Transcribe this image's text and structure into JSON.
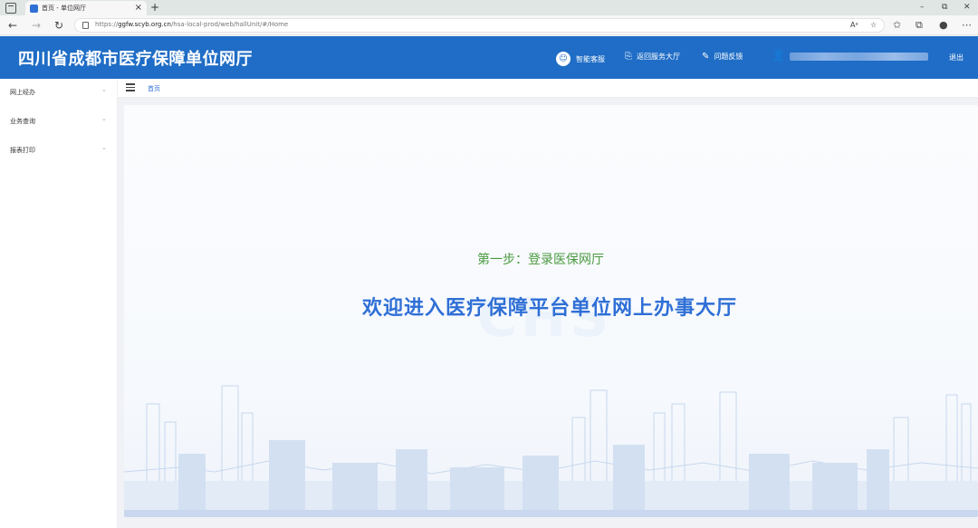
{
  "browser": {
    "tab_title": "首页 - 单位网厅",
    "url_prefix": "https://",
    "url_host": "ggfw.scyb.org.cn",
    "url_path": "/hsa-local-prod/web/hallUnit/#/Home"
  },
  "header": {
    "title": "四川省成都市医疗保障单位网厅",
    "service_label": "智能客服",
    "return_label": "返回服务大厅",
    "feedback_label": "问题反馈",
    "logout_label": "退出"
  },
  "sidebar": {
    "items": [
      {
        "label": "网上经办"
      },
      {
        "label": "业务查询"
      },
      {
        "label": "报表打印"
      }
    ]
  },
  "breadcrumb": {
    "home": "首页"
  },
  "main": {
    "step_text": "第一步：登录医保网厅",
    "welcome_text": "欢迎进入医疗保障平台单位网上办事大厅",
    "watermark": "CHS"
  },
  "colors": {
    "brand_blue": "#1f6dc6",
    "accent_blue": "#2f6fd6",
    "step_green": "#4a9a3f"
  }
}
